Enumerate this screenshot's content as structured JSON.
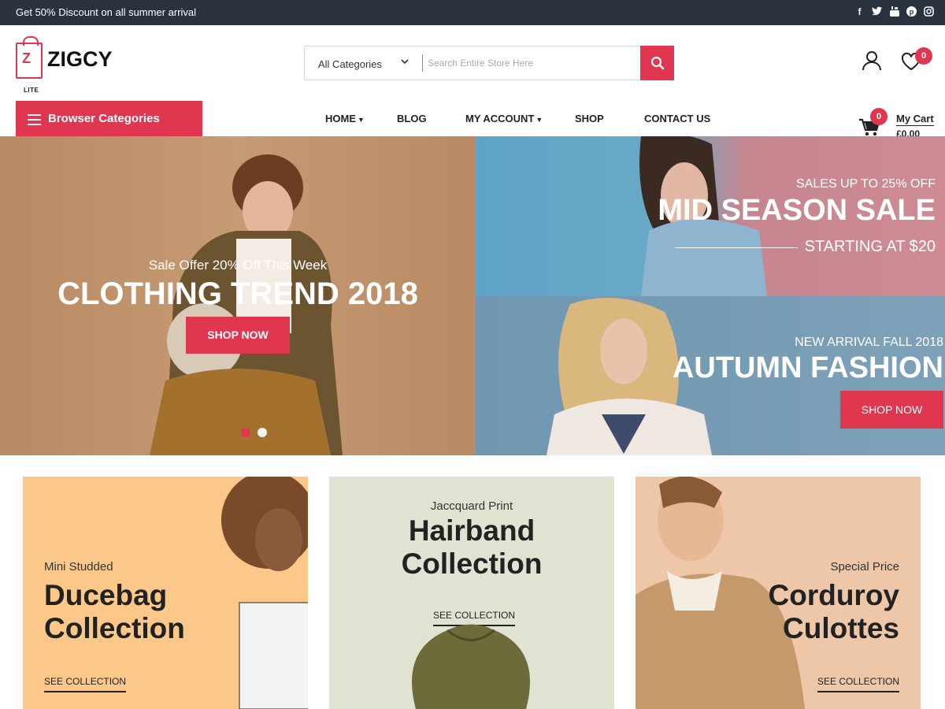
{
  "topbar": {
    "promo": "Get 50% Discount on all summer arrival",
    "social": [
      "facebook-icon",
      "twitter-icon",
      "youtube-icon",
      "pinterest-icon",
      "instagram-icon"
    ]
  },
  "header": {
    "logo_name": "ZIGCY",
    "logo_sub": "LITE",
    "search_category": "All Categories",
    "search_placeholder": "Search Entire Store Here",
    "wishlist_count": "0"
  },
  "nav": {
    "browse_label": "Browser Categories",
    "items": [
      {
        "label": "HOME",
        "has_dropdown": true
      },
      {
        "label": "BLOG",
        "has_dropdown": false
      },
      {
        "label": "MY ACCOUNT",
        "has_dropdown": true
      },
      {
        "label": "SHOP",
        "has_dropdown": false
      },
      {
        "label": "CONTACT US",
        "has_dropdown": false
      }
    ],
    "cart_count": "0",
    "cart_label": "My Cart",
    "cart_amount": "£0.00"
  },
  "hero": {
    "subtitle": "Sale Offer 20% Off This Week",
    "title": "CLOTHING TREND 2018",
    "button": "SHOP NOW",
    "slides": 2,
    "active_slide": 1
  },
  "promos": [
    {
      "small": "SALES UP TO 25% OFF",
      "title": "MID SEASON SALE",
      "tagline": "STARTING AT $20"
    },
    {
      "small": "NEW ARRIVAL FALL 2018",
      "title": "AUTUMN FASHION",
      "button": "SHOP NOW"
    }
  ],
  "collections": [
    {
      "pre": "Mini Studded",
      "line1": "Ducebag",
      "line2": "Collection",
      "link": "SEE COLLECTION"
    },
    {
      "pre": "Jaccquard Print",
      "line1": "Hairband",
      "line2": "Collection",
      "link": "SEE COLLECTION"
    },
    {
      "pre": "Special Price",
      "line1": "Corduroy",
      "line2": "Culottes",
      "link": "SEE COLLECTION"
    }
  ],
  "colors": {
    "accent": "#e0364f",
    "topbar": "#2a3240"
  }
}
